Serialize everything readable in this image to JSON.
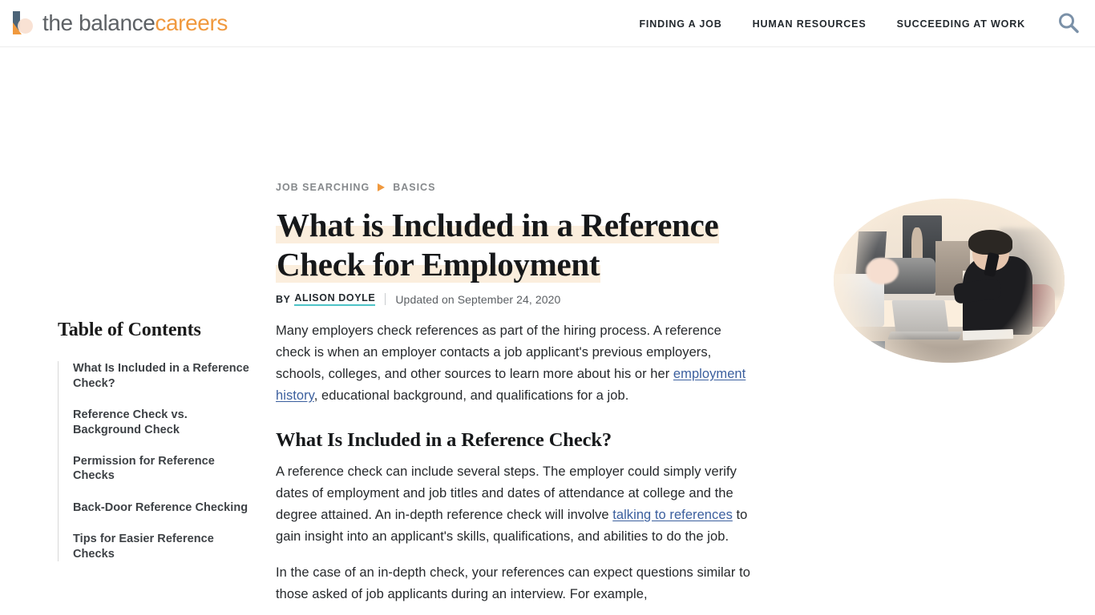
{
  "header": {
    "logo": {
      "the": "the ",
      "balance": "balance",
      "careers": "careers",
      "alt": "the balance careers"
    },
    "nav": [
      {
        "label": "FINDING A JOB"
      },
      {
        "label": "HUMAN RESOURCES"
      },
      {
        "label": "SUCCEEDING AT WORK"
      }
    ],
    "search_label": "Search"
  },
  "toc": {
    "title": "Table of Contents",
    "items": [
      {
        "label": "What Is Included in a Reference Check?"
      },
      {
        "label": "Reference Check vs. Background Check"
      },
      {
        "label": "Permission for Reference Checks"
      },
      {
        "label": "Back-Door Reference Checking"
      },
      {
        "label": "Tips for Easier Reference Checks"
      }
    ]
  },
  "article": {
    "breadcrumb": {
      "category": "JOB SEARCHING",
      "subcategory": "BASICS"
    },
    "headline": "What is Included in a Reference Check for Employment",
    "byline": {
      "by": "BY",
      "author": "ALISON DOYLE",
      "updated": "Updated on September 24, 2020"
    },
    "intro": {
      "part1": "Many employers check references as part of the hiring process. A reference check is when an employer contacts a job applicant's previous employers, schools, colleges, and other sources to learn more about his or her ",
      "link": "employment history",
      "part2": ", educational background, and qualifications for a job."
    },
    "section1": {
      "heading": "What Is Included in a Reference Check?",
      "p1_part1": "A reference check can include several steps. The employer could simply verify dates of employment and job titles and dates of attendance at college and the degree attained. An in-depth reference check will involve ",
      "p1_link": "talking to references",
      "p1_part2": " to gain insight into an applicant's skills, qualifications, and abilities to do the job.",
      "p2": "In the case of an in-depth check, your references can expect questions similar to those asked of job applicants during an interview. For example,"
    }
  },
  "colors": {
    "accent_orange": "#f0993e",
    "highlight_peach": "#fbeedd",
    "link_blue": "#3b5f9e",
    "author_underline_teal": "#4ec3c7",
    "search_icon": "#7b91a8",
    "logo_gray": "#5d6165",
    "badge_navy": "#46586d"
  }
}
